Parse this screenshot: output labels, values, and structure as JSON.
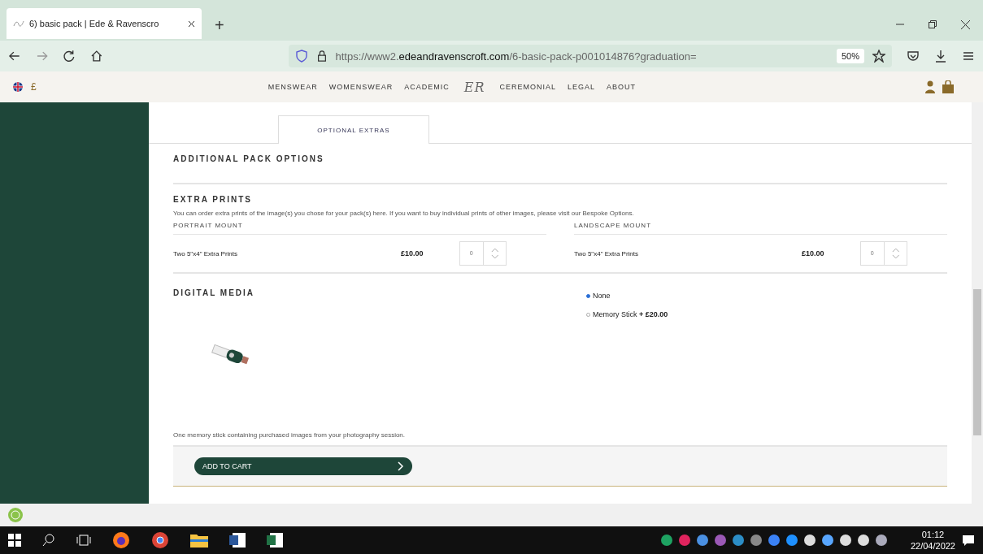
{
  "browser": {
    "tab_title": "6) basic pack | Ede & Ravenscro",
    "new_tab": "+",
    "url": "https://www2.**edeandravenscroft.com**/6-basic-pack-p001014876?graduation=",
    "zoom": "50%"
  },
  "site_header": {
    "currency": "£",
    "nav_left": [
      "MENSWEAR",
      "WOMENSWEAR",
      "ACADEMIC"
    ],
    "logo": "ER",
    "nav_right": [
      "CEREMONIAL",
      "LEGAL",
      "ABOUT"
    ]
  },
  "tabs": [
    {
      "label": "OPTIONAL EXTRAS",
      "selected": true
    }
  ],
  "section_title": "ADDITIONAL PACK OPTIONS",
  "extra_prints": {
    "title": "EXTRA PRINTS",
    "description": "You can order extra prints of the image(s) you chose for your pack(s) here. If you want to buy individual prints of other images, please visit our Bespoke Options.",
    "mounts": [
      {
        "heading": "PORTRAIT MOUNT",
        "item": "Two 5\"x4\" Extra Prints",
        "price": "£10.00",
        "quantity": "0"
      },
      {
        "heading": "LANDSCAPE MOUNT",
        "item": "Two 5\"x4\" Extra Prints",
        "price": "£10.00",
        "quantity": "0"
      }
    ]
  },
  "digital_media": {
    "title": "DIGITAL MEDIA",
    "options": [
      {
        "label": "None",
        "selected": true
      },
      {
        "label": "Memory Stick **+ £20.00**",
        "selected": false
      }
    ],
    "description": "One memory stick containing purchased images from your photography session."
  },
  "add_to_cart": "ADD TO CART",
  "taskbar": {
    "time": "01:12",
    "date": "22/04/2022"
  }
}
